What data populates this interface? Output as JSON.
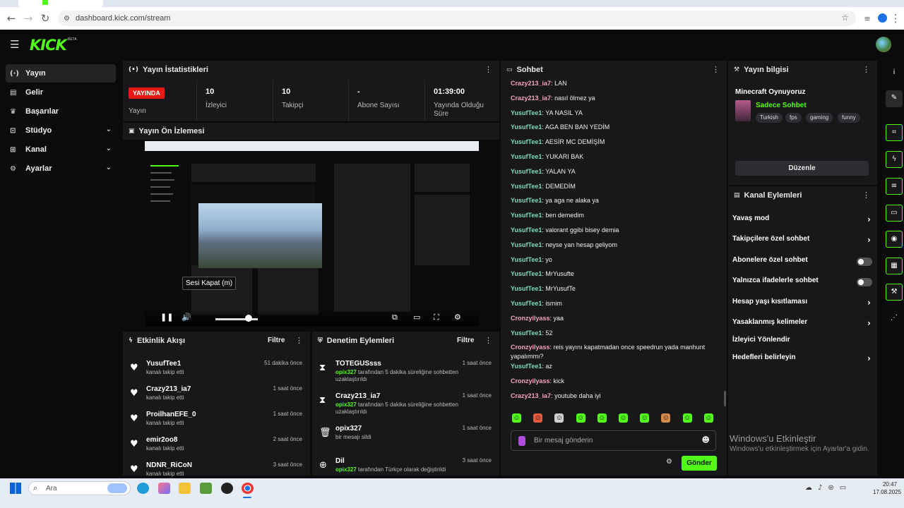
{
  "browser": {
    "url": "dashboard.kick.com/stream"
  },
  "app": {
    "logo": "KICK",
    "beta": "BETA"
  },
  "sidebar": {
    "items": [
      {
        "label": "Yayın",
        "icon": "broadcast-icon",
        "glyph": "(·)",
        "active": true,
        "expand": false
      },
      {
        "label": "Gelir",
        "icon": "revenue-icon",
        "glyph": "▤",
        "active": false,
        "expand": false
      },
      {
        "label": "Başarılar",
        "icon": "trophy-icon",
        "glyph": "♛",
        "active": false,
        "expand": false
      },
      {
        "label": "Stüdyo",
        "icon": "studio-icon",
        "glyph": "⊡",
        "active": false,
        "expand": true
      },
      {
        "label": "Kanal",
        "icon": "channel-icon",
        "glyph": "⊞",
        "active": false,
        "expand": true
      },
      {
        "label": "Ayarlar",
        "icon": "settings-icon",
        "glyph": "⚙",
        "active": false,
        "expand": true
      }
    ]
  },
  "stats": {
    "title": "Yayın İstatistikleri",
    "live_badge": "YAYINDA",
    "live_label": "Yayın",
    "items": [
      {
        "value": "10",
        "label": "İzleyici"
      },
      {
        "value": "10",
        "label": "Takipçi"
      },
      {
        "value": "-",
        "label": "Abone Sayısı"
      },
      {
        "value": "01:39:00",
        "label": "Yayında Olduğu Süre"
      }
    ]
  },
  "preview": {
    "title": "Yayın Ön İzlemesi",
    "tooltip": "Sesi Kapat (m)"
  },
  "activity": {
    "title": "Etkinlik Akışı",
    "filter": "Filtre",
    "rows": [
      {
        "user": "YusufTee1",
        "sub": "kanalı takip etti",
        "time": "51 dakika önce"
      },
      {
        "user": "Crazy213_ia7",
        "sub": "kanalı takip etti",
        "time": "1 saat önce"
      },
      {
        "user": "ProilhanEFE_0",
        "sub": "kanalı takip etti",
        "time": "1 saat önce"
      },
      {
        "user": "emir2oo8",
        "sub": "kanalı takip etti",
        "time": "2 saat önce"
      },
      {
        "user": "NDNR_RiCoN",
        "sub": "kanalı takip etti",
        "time": "3 saat önce"
      }
    ]
  },
  "moderation": {
    "title": "Denetim Eylemleri",
    "filter": "Filtre",
    "rows": [
      {
        "icon": "hourglass-icon",
        "glyph": "⧗",
        "user": "TOTEGUSsss",
        "actor": "opix327",
        "rest": "tarafından 5 dakika süreliğine sohbetten uzaklaştırıldı",
        "time": "1 saat önce"
      },
      {
        "icon": "hourglass-icon",
        "glyph": "⧗",
        "user": "Crazy213_ia7",
        "actor": "opix327",
        "rest": "tarafından 5 dakika süreliğine sohbetten uzaklaştırıldı",
        "time": "1 saat önce"
      },
      {
        "icon": "trash-icon",
        "glyph": "🗑",
        "user": "opix327",
        "actor": "",
        "rest": "bir mesajı sildi",
        "time": "1 saat önce"
      },
      {
        "icon": "globe-icon",
        "glyph": "⊕",
        "user": "Dil",
        "actor": "opix327",
        "rest": "tarafından Türkçe olarak değiştirildi",
        "time": "3 saat önce"
      }
    ]
  },
  "chat": {
    "title": "Sohbet",
    "placeholder": "Bir mesaj gönderin",
    "send": "Gönder",
    "messages": [
      {
        "user": "Crazy213_ia7",
        "color": "#f5a3b5",
        "text": "LAN"
      },
      {
        "user": "Crazy213_ia7",
        "color": "#f5a3b5",
        "text": "nasıl ölmez ya"
      },
      {
        "user": "YusufTee1",
        "color": "#7bdcb5",
        "text": "YA NASIL YA"
      },
      {
        "user": "YusufTee1",
        "color": "#7bdcb5",
        "text": "AGA BEN BAN YEDİM"
      },
      {
        "user": "YusufTee1",
        "color": "#7bdcb5",
        "text": "AESİR MC DEMİŞİM"
      },
      {
        "user": "YusufTee1",
        "color": "#7bdcb5",
        "text": "YUKARI BAK"
      },
      {
        "user": "YusufTee1",
        "color": "#7bdcb5",
        "text": "YALAN YA"
      },
      {
        "user": "YusufTee1",
        "color": "#7bdcb5",
        "text": "DEMEDİM"
      },
      {
        "user": "YusufTee1",
        "color": "#7bdcb5",
        "text": "ya aga ne alaka ya"
      },
      {
        "user": "YusufTee1",
        "color": "#7bdcb5",
        "text": "ben demedim"
      },
      {
        "user": "YusufTee1",
        "color": "#7bdcb5",
        "text": "valorant ggibi bisey demia"
      },
      {
        "user": "YusufTee1",
        "color": "#7bdcb5",
        "text": "neyse yan hesap geliyom"
      },
      {
        "user": "YusufTee1",
        "color": "#7bdcb5",
        "text": "yo"
      },
      {
        "user": "YusufTee1",
        "color": "#7bdcb5",
        "text": "MrYusufte"
      },
      {
        "user": "YusufTee1",
        "color": "#7bdcb5",
        "text": "MrYusufTe"
      },
      {
        "user": "YusufTee1",
        "color": "#7bdcb5",
        "text": "ismim"
      },
      {
        "user": "Cronzyilyass",
        "color": "#f5a3b5",
        "text": "yaa"
      },
      {
        "user": "YusufTee1",
        "color": "#7bdcb5",
        "text": "52"
      },
      {
        "user": "Cronzyilyass",
        "color": "#f5a3b5",
        "text": "reis yayını kapatmadan once speedrun yada manhunt yapalımmı?"
      },
      {
        "user": "YusufTee1",
        "color": "#7bdcb5",
        "text": "az"
      },
      {
        "user": "Cronzyilyass",
        "color": "#f5a3b5",
        "text": "kick"
      },
      {
        "user": "Crazy213_ia7",
        "color": "#f5a3b5",
        "text": "youtube daha iyi"
      }
    ],
    "emotes": [
      "#53fc18",
      "#e45a3a",
      "#cfcfcf",
      "#53fc18",
      "#53fc18",
      "#53fc18",
      "#53fc18",
      "#d48a4a",
      "#53fc18",
      "#53fc18"
    ]
  },
  "stream_info": {
    "title": "Yayın bilgisi",
    "stream_title": "Minecraft Oynuyoruz",
    "category": "Sadece Sohbet",
    "tags": [
      "Turkish",
      "fps",
      "gaming",
      "funny"
    ],
    "edit": "Düzenle"
  },
  "channel_actions": {
    "title": "Kanal Eylemleri",
    "rows": [
      {
        "label": "Yavaş mod",
        "kind": "arrow"
      },
      {
        "label": "Takipçilere özel sohbet",
        "kind": "arrow"
      },
      {
        "label": "Abonelere özel sohbet",
        "kind": "toggle"
      },
      {
        "label": "Yalnızca ifadelerle sohbet",
        "kind": "toggle"
      },
      {
        "label": "Hesap yaşı kısıtlaması",
        "kind": "arrow"
      },
      {
        "label": "Yasaklanmış kelimeler",
        "kind": "arrow"
      },
      {
        "label": "İzleyici Yönlendir",
        "kind": "none"
      },
      {
        "label": "Hedefleri belirleyin",
        "kind": "arrow"
      }
    ]
  },
  "rail": [
    {
      "icon": "info-icon",
      "glyph": "i"
    },
    {
      "icon": "pencil-icon",
      "glyph": "✎"
    },
    {
      "icon": "scan-icon",
      "glyph": "⌗"
    },
    {
      "icon": "bolt-icon",
      "glyph": "ϟ"
    },
    {
      "icon": "notes-icon",
      "glyph": "≡"
    },
    {
      "icon": "chat-icon",
      "glyph": "▭"
    },
    {
      "icon": "broadcast-icon",
      "glyph": "◉"
    },
    {
      "icon": "layout-icon",
      "glyph": "▦"
    },
    {
      "icon": "wrench-icon",
      "glyph": "⚒"
    },
    {
      "icon": "share-icon",
      "glyph": "⋰"
    }
  ],
  "watermark": {
    "line1": "Windows'u Etkinleştir",
    "line2": "Windows'u etkinleştirmek için Ayarlar'a gidin."
  },
  "taskbar": {
    "search": "Ara",
    "time": "20:47",
    "date": "17.08.2025"
  }
}
